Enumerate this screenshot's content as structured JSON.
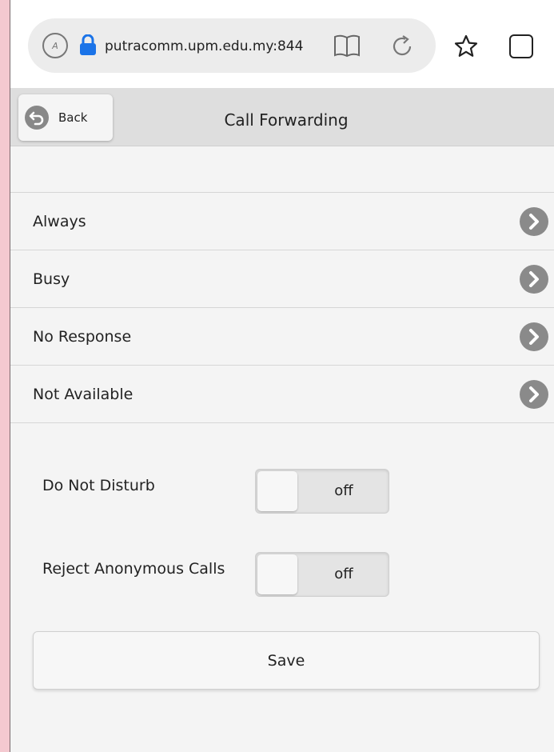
{
  "browser": {
    "url": "putracomm.upm.edu.my:844"
  },
  "header": {
    "back_label": "Back",
    "title": "Call Forwarding"
  },
  "forwarding_items": [
    {
      "label": "Always"
    },
    {
      "label": "Busy"
    },
    {
      "label": "No Response"
    },
    {
      "label": "Not Available"
    }
  ],
  "settings": {
    "dnd": {
      "label": "Do Not Disturb",
      "state": "off"
    },
    "reject_anonymous": {
      "label": "Reject Anonymous Calls",
      "state": "off"
    }
  },
  "save_label": "Save",
  "colors": {
    "accent_lock": "#1a73e8",
    "chevron": "#8a8a8a",
    "side_background": "#f4c9d0"
  },
  "icons": [
    "reader-mode-icon",
    "lock-icon",
    "bookmarks-icon",
    "reload-icon",
    "star-icon",
    "tabs-icon",
    "back-arrow-icon",
    "chevron-right-icon"
  ]
}
